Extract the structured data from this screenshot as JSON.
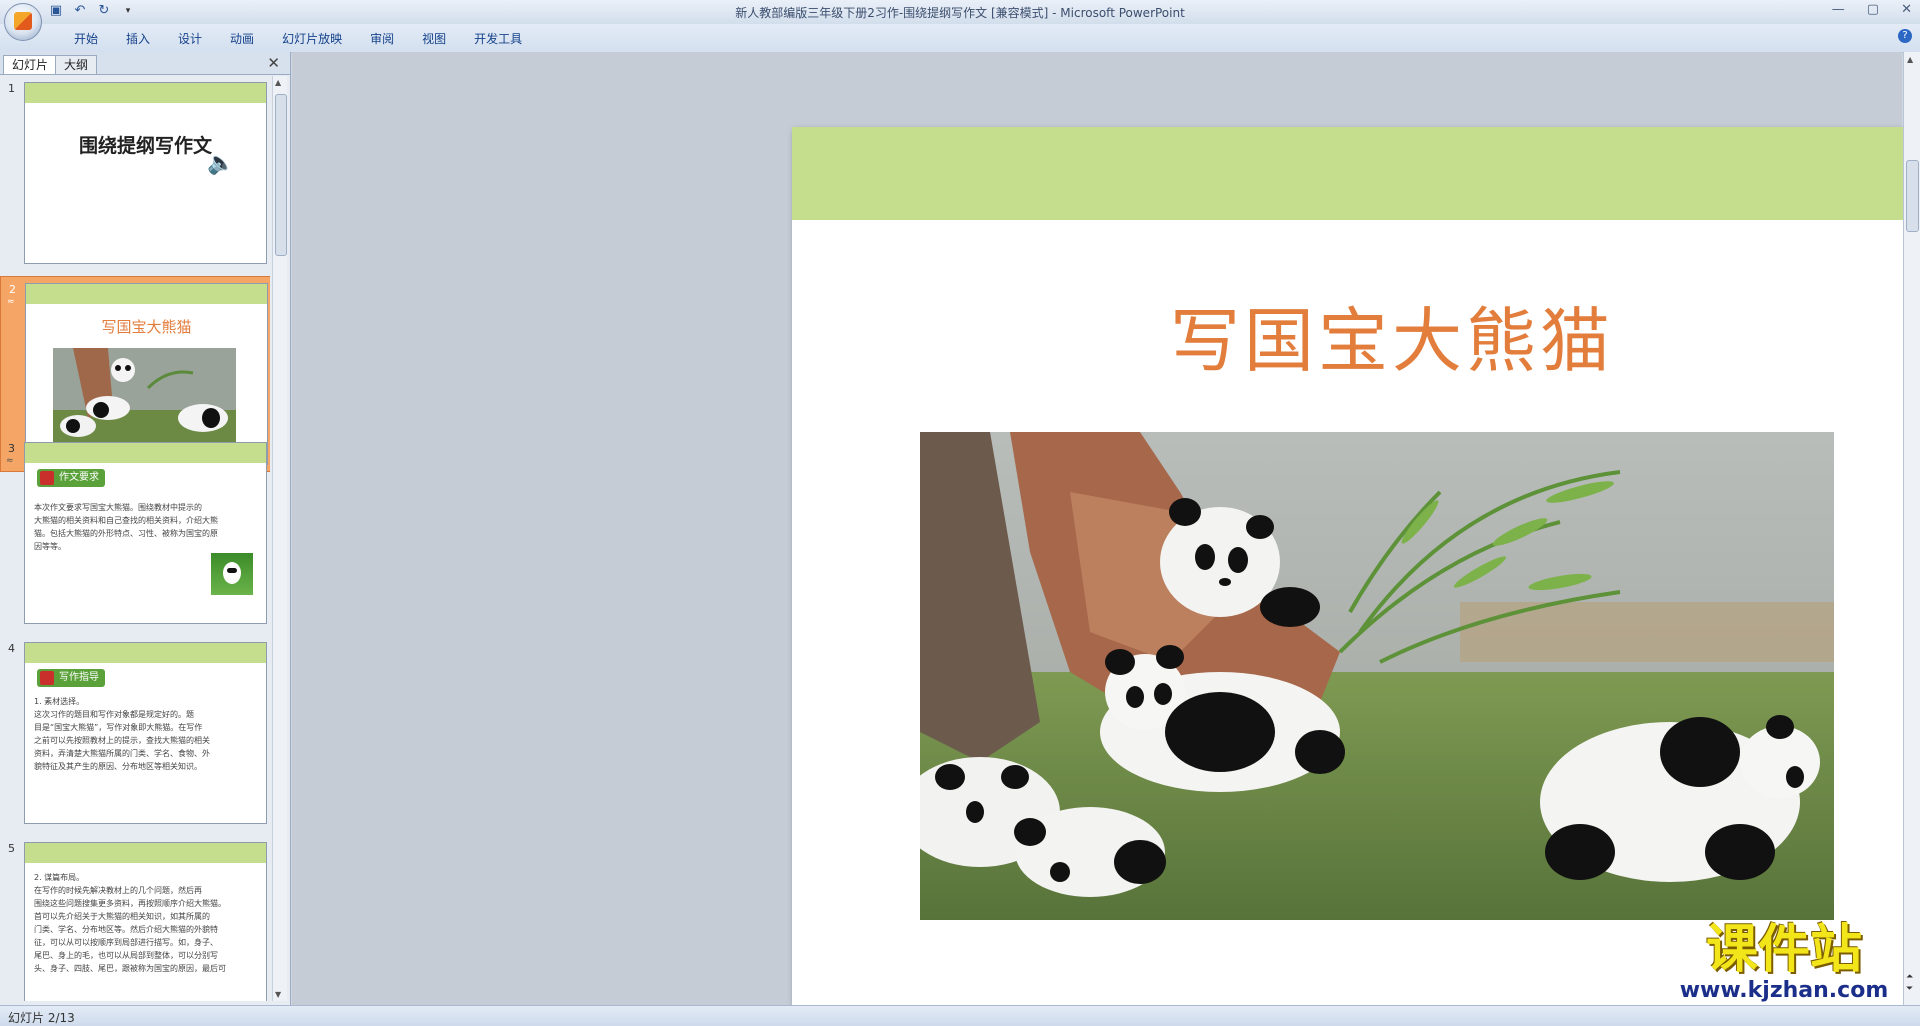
{
  "app": {
    "title": "新人教部编版三年级下册2习作-围绕提纲写作文 [兼容模式] - Microsoft PowerPoint"
  },
  "quick_access": {
    "save_icon": "save-icon",
    "undo_icon": "undo-icon",
    "redo_icon": "redo-icon"
  },
  "ribbon": {
    "tabs": [
      "开始",
      "插入",
      "设计",
      "动画",
      "幻灯片放映",
      "审阅",
      "视图",
      "开发工具"
    ]
  },
  "left_panel": {
    "tabs": [
      "幻灯片",
      "大纲"
    ],
    "slides": [
      {
        "num": "1",
        "anim": "",
        "title": "围绕提纲写作文"
      },
      {
        "num": "2",
        "anim": "≈",
        "title": "写国宝大熊猫"
      },
      {
        "num": "3",
        "anim": "≈",
        "badge": "作文要求",
        "text": [
          "本次作文要求写国宝大熊猫。围绕教材中提示的",
          "大熊猫的相关资料和自己查找的相关资料，介绍大熊",
          "猫。包括大熊猫的外形特点、习性、被称为国宝的原",
          "因等等。"
        ]
      },
      {
        "num": "4",
        "anim": "",
        "badge": "写作指导",
        "text": [
          "1. 素材选择。",
          "这次习作的题目和写作对象都是规定好的。题",
          "目是“国宝大熊猫”，写作对象即大熊猫。在写作",
          "之前可以先按照教材上的提示，查找大熊猫的相关",
          "资料，弄清楚大熊猫所属的门类、学名、食物、外",
          "貌特征及其产生的原因、分布地区等相关知识。"
        ]
      },
      {
        "num": "5",
        "anim": "",
        "text": [
          "2. 谋篇布局。",
          "在写作的时候先解决教材上的几个问题，然后再",
          "围绕这些问题搜集更多资料，再按照顺序介绍大熊猫。",
          "首可以先介绍关于大熊猫的相关知识，如其所属的",
          "门类、学名、分布地区等。然后介绍大熊猫的外貌特",
          "征，可以从可以按顺序到局部进行描写。如，身子、",
          "尾巴、身上的毛，也可以从局部到整体，可以分别写",
          "头、身子、四肢、尾巴，跟被称为国宝的原因，最后可"
        ]
      }
    ]
  },
  "slide": {
    "title": "写国宝大熊猫"
  },
  "statusbar": {
    "text": "幻灯片 2/13"
  },
  "watermark": {
    "cn": "课件站",
    "url": "www.kjzhan.com"
  },
  "colors": {
    "band": "#c4de8e",
    "title": "#e27d3c"
  }
}
